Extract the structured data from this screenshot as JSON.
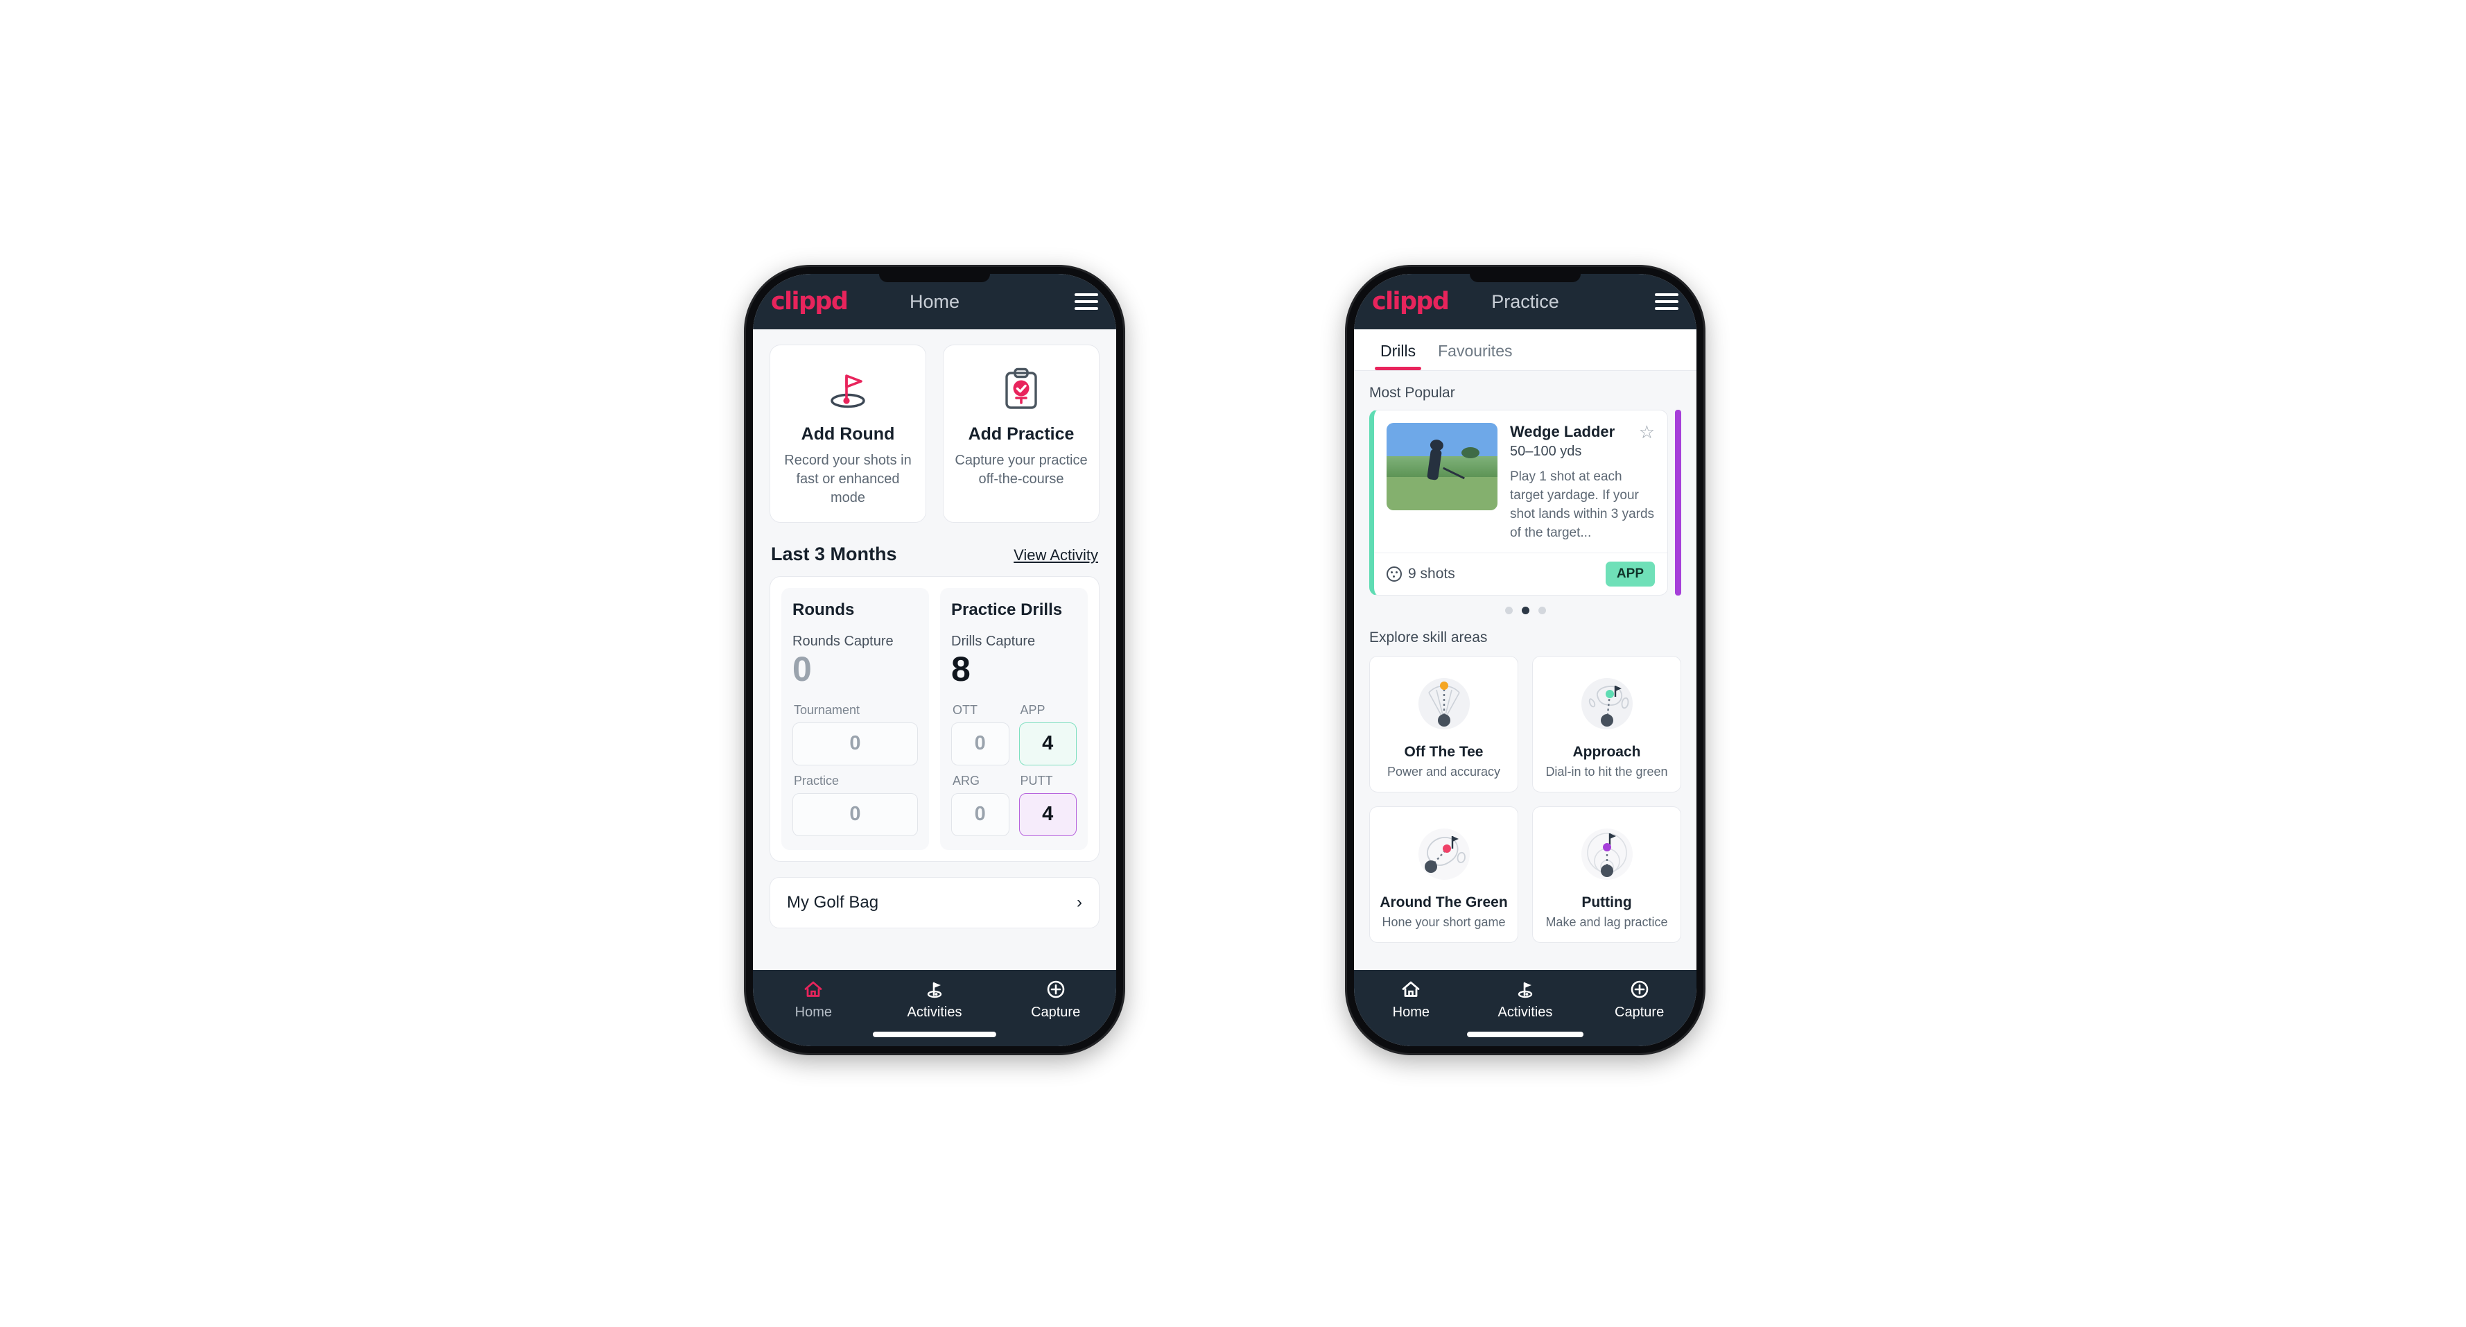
{
  "brand": {
    "logo_text": "clippd",
    "accent_pink": "#e8245c",
    "navy": "#1e2a36",
    "mint": "#6fe0b8",
    "purple": "#a63fd9"
  },
  "phone1": {
    "appbar": {
      "title": "Home",
      "menu_icon": "hamburger-menu-icon"
    },
    "quick_actions": [
      {
        "icon": "golf-flag-hole-icon",
        "title": "Add Round",
        "subtitle": "Record your shots in fast or enhanced mode"
      },
      {
        "icon": "clipboard-check-icon",
        "title": "Add Practice",
        "subtitle": "Capture your practice off-the-course"
      }
    ],
    "section": {
      "title": "Last 3 Months",
      "link": "View Activity"
    },
    "rounds": {
      "heading": "Rounds",
      "capture_label": "Rounds Capture",
      "capture_value": "0",
      "items": [
        {
          "label": "Tournament",
          "value": "0",
          "state": "empty"
        },
        {
          "label": "Practice",
          "value": "0",
          "state": "empty"
        }
      ]
    },
    "drills": {
      "heading": "Practice Drills",
      "capture_label": "Drills Capture",
      "capture_value": "8",
      "items": [
        {
          "label": "OTT",
          "value": "0",
          "state": "empty"
        },
        {
          "label": "APP",
          "value": "4",
          "state": "app"
        },
        {
          "label": "ARG",
          "value": "0",
          "state": "empty"
        },
        {
          "label": "PUTT",
          "value": "4",
          "state": "putt"
        }
      ]
    },
    "golf_bag": {
      "label": "My Golf Bag",
      "chevron": "chevron-right-icon"
    },
    "bottom_nav": [
      {
        "icon": "home-icon",
        "label": "Home",
        "active": true
      },
      {
        "icon": "golf-flag-icon",
        "label": "Activities",
        "active": false
      },
      {
        "icon": "plus-circle-icon",
        "label": "Capture",
        "active": false
      }
    ]
  },
  "phone2": {
    "appbar": {
      "title": "Practice",
      "menu_icon": "hamburger-menu-icon"
    },
    "tabs": [
      {
        "label": "Drills",
        "active": true
      },
      {
        "label": "Favourites",
        "active": false
      }
    ],
    "most_popular_label": "Most Popular",
    "drill_card": {
      "title": "Wedge Ladder",
      "yardage": "50–100 yds",
      "description": "Play 1 shot at each target yardage. If your shot lands within 3 yards of the target...",
      "shots": "9 shots",
      "shots_icon": "golf-ball-icon",
      "badge": "APP",
      "star_icon": "star-outline-icon"
    },
    "carousel_dots": {
      "count": 3,
      "active_index": 1
    },
    "explore_label": "Explore skill areas",
    "skills": [
      {
        "icon": "tee-fan-icon",
        "title": "Off The Tee",
        "subtitle": "Power and accuracy"
      },
      {
        "icon": "green-approach-icon",
        "title": "Approach",
        "subtitle": "Dial-in to hit the green"
      },
      {
        "icon": "chip-green-icon",
        "title": "Around The Green",
        "subtitle": "Hone your short game"
      },
      {
        "icon": "putting-rings-icon",
        "title": "Putting",
        "subtitle": "Make and lag practice"
      }
    ],
    "bottom_nav": [
      {
        "icon": "home-icon",
        "label": "Home",
        "active": false
      },
      {
        "icon": "golf-flag-icon",
        "label": "Activities",
        "active": false
      },
      {
        "icon": "plus-circle-icon",
        "label": "Capture",
        "active": false
      }
    ]
  }
}
